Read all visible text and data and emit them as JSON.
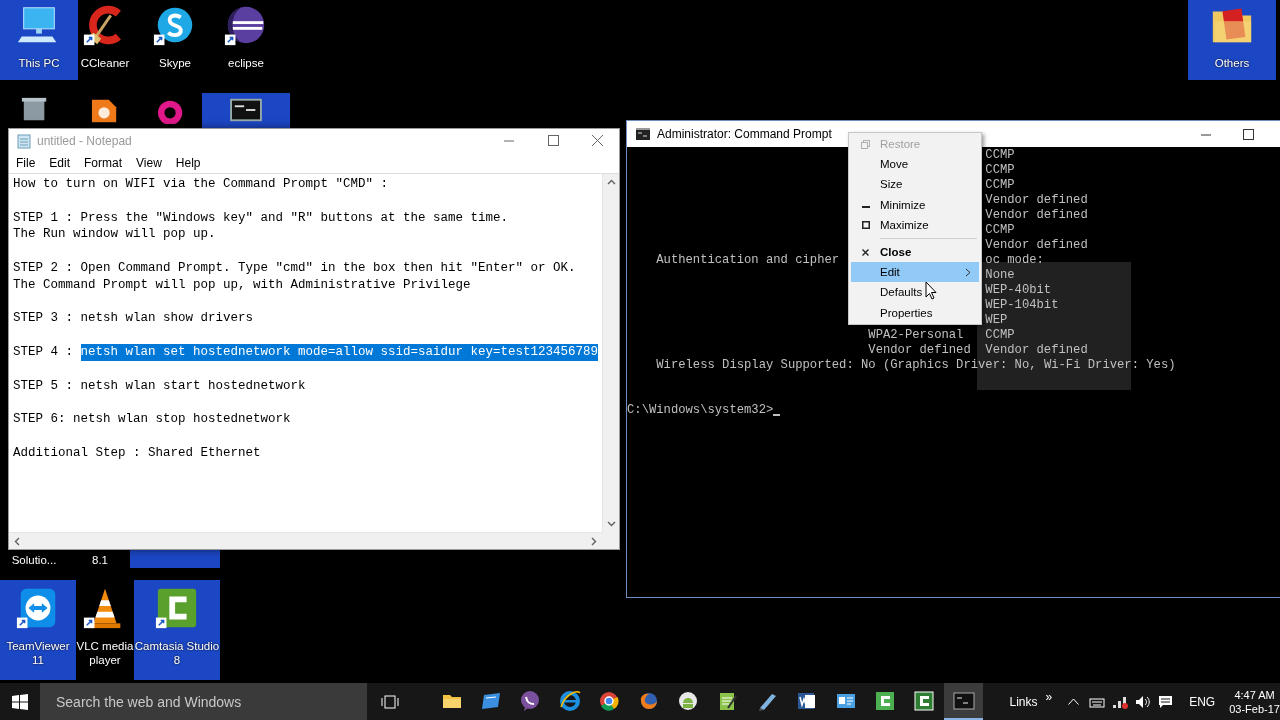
{
  "desktop_icons": [
    {
      "label": "This PC",
      "kind": "computer",
      "selected": true
    },
    {
      "label": "CCleaner",
      "kind": "ccleaner",
      "selected": false
    },
    {
      "label": "Skype",
      "kind": "skype",
      "selected": false
    },
    {
      "label": "eclipse",
      "kind": "eclipse",
      "selected": false
    },
    {
      "label": "Others",
      "kind": "folder",
      "selected": true
    },
    {
      "kind": "recycle",
      "selected": false
    },
    {
      "kind": "orange",
      "selected": false
    },
    {
      "kind": "magenta",
      "selected": false
    },
    {
      "kind": "console",
      "selected": true
    },
    {
      "label": "Solutio...",
      "kind": "hidden",
      "selected": false
    },
    {
      "label": "8.1",
      "kind": "hidden",
      "selected": false
    },
    {
      "kind": "hidden",
      "selected": true
    },
    {
      "label": "TeamViewer 11",
      "kind": "teamviewer",
      "selected": true
    },
    {
      "label": "VLC media player",
      "kind": "vlc",
      "selected": false
    },
    {
      "label": "Camtasia Studio 8",
      "kind": "camtasia",
      "selected": true
    }
  ],
  "notepad": {
    "title": "untitled - Notepad",
    "menu": [
      "File",
      "Edit",
      "Format",
      "View",
      "Help"
    ],
    "paragraphs": [
      {
        "lines": [
          {
            "spans": [
              {
                "text": "How to turn on WIFI via the Command Prompt \"CMD\" :",
                "selected": false
              }
            ]
          }
        ]
      },
      {
        "lines": [
          {
            "spans": [
              {
                "text": "STEP 1 : Press the \"Windows key\" and \"R\" buttons at the same time.",
                "selected": false
              }
            ]
          },
          {
            "spans": [
              {
                "text": "The Run window will pop up.",
                "selected": false
              }
            ]
          }
        ]
      },
      {
        "lines": [
          {
            "spans": [
              {
                "text": "STEP 2 : Open Command Prompt. Type \"cmd\" in the box then hit \"Enter\" or OK.",
                "selected": false
              }
            ]
          },
          {
            "spans": [
              {
                "text": "The Command Prompt will pop up, with Administrative Privilege",
                "selected": false
              }
            ]
          }
        ]
      },
      {
        "lines": [
          {
            "spans": [
              {
                "text": "STEP 3 : netsh wlan show drivers",
                "selected": false
              }
            ]
          }
        ]
      },
      {
        "lines": [
          {
            "spans": [
              {
                "text": "STEP 4 : ",
                "selected": false
              },
              {
                "text": "netsh wlan set hostednetwork mode=allow ssid=saidur key=test123456789",
                "selected": true
              }
            ]
          }
        ]
      },
      {
        "lines": [
          {
            "spans": [
              {
                "text": "STEP 5 : netsh wlan start hostednetwork",
                "selected": false
              }
            ]
          }
        ]
      },
      {
        "lines": [
          {
            "spans": [
              {
                "text": "STEP 6: netsh wlan stop hostednetwork",
                "selected": false
              }
            ]
          }
        ]
      },
      {
        "lines": [
          {
            "spans": [
              {
                "text": "Additional Step : Shared Ethernet",
                "selected": false
              }
            ]
          }
        ]
      }
    ]
  },
  "command_prompt": {
    "title": "Administrator: Command Prompt",
    "rows": [
      {
        "kind": "row",
        "column_3": "CCMP"
      },
      {
        "kind": "row",
        "column_3": "CCMP"
      },
      {
        "kind": "row",
        "column_3": "CCMP"
      },
      {
        "kind": "row",
        "column_3": "Vendor defined"
      },
      {
        "kind": "row",
        "column_3": "Vendor defined"
      },
      {
        "kind": "row",
        "column_3": "CCMP"
      },
      {
        "kind": "row",
        "column_3": "Vendor defined"
      },
      {
        "kind": "row",
        "column_1": "Authentication and cipher",
        "column_3": "oc mode:"
      },
      {
        "kind": "row",
        "column_3": "None"
      },
      {
        "kind": "row",
        "column_3": "WEP-40bit"
      },
      {
        "kind": "row",
        "column_3": "WEP-104bit"
      },
      {
        "kind": "row",
        "column_3": "WEP"
      },
      {
        "kind": "row",
        "column_2": "WPA2-Personal",
        "column_3": "CCMP"
      },
      {
        "kind": "row",
        "column_2": "Vendor defined",
        "column_3": "Vendor defined"
      },
      {
        "kind": "row",
        "column_1": "Wireless Display Supported: No (Graphics Driver: No, Wi-Fi Driver: Yes)"
      },
      {
        "kind": "blank"
      },
      {
        "kind": "blank"
      },
      {
        "kind": "prompt",
        "text": "C:\\Windows\\system32>"
      }
    ]
  },
  "system_menu": {
    "items": [
      {
        "label": "Restore",
        "kind": "restore",
        "disabled": true,
        "selected": false,
        "default": false
      },
      {
        "label": "Move",
        "kind": "plain",
        "disabled": false,
        "selected": false,
        "default": false
      },
      {
        "label": "Size",
        "kind": "plain",
        "disabled": false,
        "selected": false,
        "default": false
      },
      {
        "label": "Minimize",
        "kind": "minimize",
        "disabled": false,
        "selected": false,
        "default": false
      },
      {
        "label": "Maximize",
        "kind": "maximize",
        "disabled": false,
        "selected": false,
        "default": false
      },
      {
        "kind": "separator"
      },
      {
        "label": "Close",
        "kind": "close",
        "disabled": false,
        "selected": false,
        "default": true
      },
      {
        "label": "Edit",
        "kind": "submenu",
        "disabled": false,
        "selected": true,
        "default": false
      },
      {
        "label": "Defaults",
        "kind": "plain",
        "disabled": false,
        "selected": false,
        "default": false
      },
      {
        "label": "Properties",
        "kind": "plain",
        "disabled": false,
        "selected": false,
        "default": false
      }
    ]
  },
  "taskbar": {
    "search": {
      "placeholder": "Search the web and Windows"
    },
    "apps": [
      {
        "kind": "folder",
        "selected": false
      },
      {
        "kind": "tablet",
        "selected": false
      },
      {
        "kind": "viber",
        "selected": false
      },
      {
        "kind": "ie",
        "selected": false
      },
      {
        "kind": "chrome",
        "selected": false
      },
      {
        "kind": "firefox",
        "selected": false
      },
      {
        "kind": "android",
        "selected": false
      },
      {
        "kind": "notepad",
        "selected": false
      },
      {
        "kind": "pen",
        "selected": false
      },
      {
        "kind": "word",
        "selected": false
      },
      {
        "kind": "card",
        "selected": false
      },
      {
        "kind": "camtasia",
        "selected": false
      },
      {
        "kind": "recorder",
        "selected": false
      },
      {
        "kind": "console",
        "selected": true
      }
    ],
    "toolbar_label": "Links",
    "toolbar_chevron": "»",
    "language": "ENG",
    "time": "4:47 AM",
    "date": "03-Feb-17"
  }
}
